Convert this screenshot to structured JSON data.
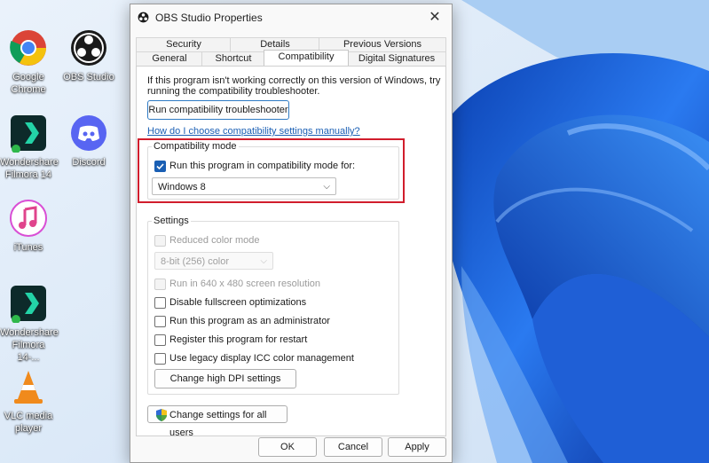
{
  "desktop": {
    "icons": [
      {
        "name": "google-chrome",
        "label": "Google\nChrome"
      },
      {
        "name": "obs-studio",
        "label": "OBS Studio"
      },
      {
        "name": "wondershare-filmora",
        "label": "Wondershare\nFilmora 14"
      },
      {
        "name": "discord",
        "label": "Discord"
      },
      {
        "name": "itunes",
        "label": "iTunes"
      },
      {
        "name": "wondershare-filmora-2",
        "label": "Wondershare\nFilmora 14-..."
      },
      {
        "name": "vlc",
        "label": "VLC media\nplayer"
      }
    ]
  },
  "dialog": {
    "title": "OBS Studio Properties",
    "close": "✕",
    "tabs_top": [
      "Security",
      "Details",
      "Previous Versions"
    ],
    "tabs_bottom": [
      "General",
      "Shortcut",
      "Compatibility",
      "Digital Signatures"
    ],
    "active_tab": "Compatibility",
    "intro_line1": "If this program isn't working correctly on this version of Windows, try",
    "intro_line2": "running the compatibility troubleshooter.",
    "troubleshooter_button": "Run compatibility troubleshooter",
    "manual_link": "How do I choose compatibility settings manually?",
    "compat_mode": {
      "title": "Compatibility mode",
      "checkbox_label": "Run this program in compatibility mode for:",
      "checked": true,
      "selected_os": "Windows 8"
    },
    "settings": {
      "title": "Settings",
      "reduced_color": "Reduced color mode",
      "color_select": "8-bit (256) color",
      "run_640": "Run in 640 x 480 screen resolution",
      "disable_fullscreen": "Disable fullscreen optimizations",
      "run_admin": "Run this program as an administrator",
      "register_restart": "Register this program for restart",
      "legacy_icc": "Use legacy display ICC color management",
      "high_dpi_button": "Change high DPI settings"
    },
    "all_users_button": "Change settings for all users",
    "ok": "OK",
    "cancel": "Cancel",
    "apply": "Apply"
  },
  "colors": {
    "accent": "#1a5fb4",
    "highlight": "#d11d2c",
    "link": "#1a5fb4"
  }
}
